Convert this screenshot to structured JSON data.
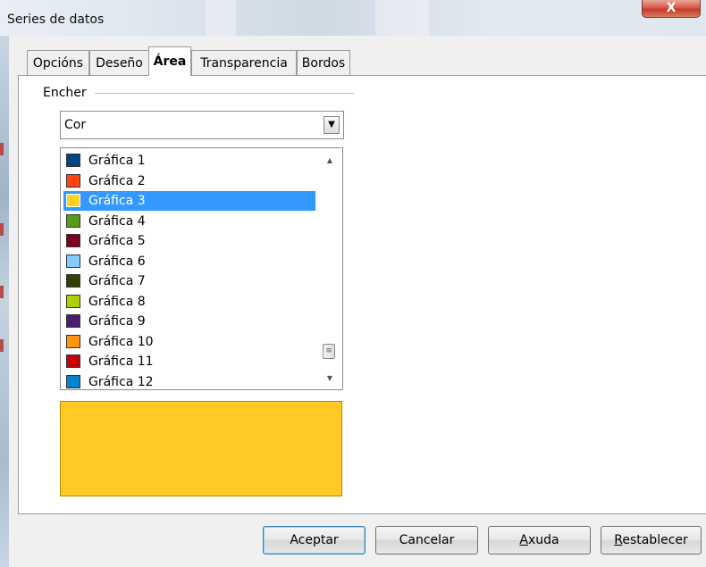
{
  "window": {
    "title": "Series de datos",
    "close_glyph": "X"
  },
  "tabs": [
    {
      "label": "Opcións",
      "active": false
    },
    {
      "label": "Deseño",
      "active": false
    },
    {
      "label": "Área",
      "active": true
    },
    {
      "label": "Transparencia",
      "active": false
    },
    {
      "label": "Bordos",
      "active": false
    }
  ],
  "fill": {
    "group_label": "Encher",
    "type_value": "Cor",
    "selected_index": 2,
    "colors": [
      {
        "label": "Gráfica 1",
        "color": "#004586"
      },
      {
        "label": "Gráfica 2",
        "color": "#ff420e"
      },
      {
        "label": "Gráfica 3",
        "color": "#ffd320"
      },
      {
        "label": "Gráfica 4",
        "color": "#579d1c"
      },
      {
        "label": "Gráfica 5",
        "color": "#7e0021"
      },
      {
        "label": "Gráfica 6",
        "color": "#83caff"
      },
      {
        "label": "Gráfica 7",
        "color": "#314004"
      },
      {
        "label": "Gráfica 8",
        "color": "#aecf00"
      },
      {
        "label": "Gráfica 9",
        "color": "#4b1f6f"
      },
      {
        "label": "Gráfica 10",
        "color": "#ff950e"
      },
      {
        "label": "Gráfica 11",
        "color": "#c5000b"
      },
      {
        "label": "Gráfica 12",
        "color": "#0084d1"
      }
    ],
    "preview_color": "#ffc926"
  },
  "buttons": {
    "ok": "Aceptar",
    "cancel": "Cancelar",
    "help_mnemonic": "A",
    "help_rest": "xuda",
    "reset_mnemonic": "R",
    "reset_rest": "establecer"
  }
}
